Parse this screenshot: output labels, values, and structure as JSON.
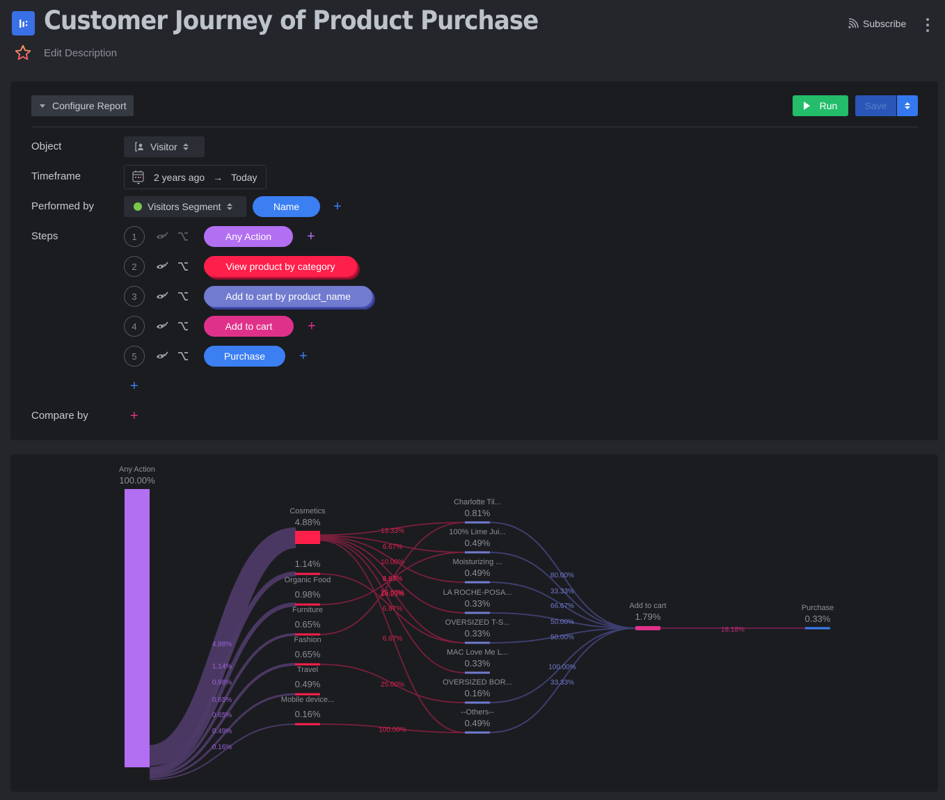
{
  "header": {
    "title": "Customer Journey of Product Purchase",
    "edit_description": "Edit Description",
    "subscribe": "Subscribe",
    "logo_icon": "bar-chart-logo-icon",
    "star_icon": "star-icon",
    "more_icon": "more-vertical-icon"
  },
  "config": {
    "configure_label": "Configure Report",
    "run_label": "Run",
    "save_label": "Save",
    "object": {
      "label": "Object",
      "value": "Visitor"
    },
    "timeframe": {
      "label": "Timeframe",
      "from": "2 years ago",
      "arrow": "→",
      "to": "Today"
    },
    "performed_by": {
      "label": "Performed by",
      "segment": "Visitors Segment",
      "segment_color": "#7bc74d",
      "property": "Name"
    },
    "steps_label": "Steps",
    "steps": [
      {
        "num": "1",
        "label": "Any Action",
        "color": "#b26ff2",
        "has_plus": true,
        "plus_color": "#b26ff2"
      },
      {
        "num": "2",
        "label": "View product by category",
        "color": "#ff1f4b",
        "has_plus": false
      },
      {
        "num": "3",
        "label": "Add to cart by product_name",
        "color": "#717bcf",
        "has_plus": false
      },
      {
        "num": "4",
        "label": "Add to cart",
        "color": "#e0318a",
        "has_plus": true,
        "plus_color": "#e0318a"
      },
      {
        "num": "5",
        "label": "Purchase",
        "color": "#3b7ff2",
        "has_plus": true,
        "plus_color": "#3b7ff2"
      }
    ],
    "compare_by_label": "Compare by",
    "plus": "+"
  },
  "chart_data": {
    "type": "sankey",
    "columns": [
      {
        "step": "Any Action",
        "color": "#b26ff2",
        "nodes": [
          {
            "name": "Any Action",
            "value": "100.00%"
          }
        ]
      },
      {
        "step": "View product by category",
        "color": "#ff1f4b",
        "nodes": [
          {
            "name": "Cosmetics",
            "value": "4.88%"
          },
          {
            "name": "",
            "value": "1.14%"
          },
          {
            "name": "Organic Food",
            "value": "0.98%"
          },
          {
            "name": "Furniture",
            "value": "0.65%"
          },
          {
            "name": "Fashion",
            "value": "0.65%"
          },
          {
            "name": "Travel",
            "value": "0.49%"
          },
          {
            "name": "Mobile device...",
            "value": "0.16%"
          }
        ]
      },
      {
        "step": "Add to cart by product_name",
        "color": "#717bcf",
        "nodes": [
          {
            "name": "Charlotte Til...",
            "value": "0.81%"
          },
          {
            "name": "100% Lime Jui...",
            "value": "0.49%"
          },
          {
            "name": "Moisturizing ...",
            "value": "0.49%"
          },
          {
            "name": "LA ROCHE-POSA...",
            "value": "0.33%"
          },
          {
            "name": "OVERSIZED T-S...",
            "value": "0.33%"
          },
          {
            "name": "MAC Love Me L...",
            "value": "0.33%"
          },
          {
            "name": "OVERSIZED BOR...",
            "value": "0.16%"
          },
          {
            "name": "--Others--",
            "value": "0.49%"
          }
        ]
      },
      {
        "step": "Add to cart",
        "color": "#e0318a",
        "nodes": [
          {
            "name": "Add to cart",
            "value": "1.79%"
          }
        ]
      },
      {
        "step": "Purchase",
        "color": "#3b7ff2",
        "nodes": [
          {
            "name": "Purchase",
            "value": "0.33%"
          }
        ]
      }
    ],
    "links_step1_to_2": [
      {
        "to": 0,
        "label": "4.88%",
        "value": 4.88
      },
      {
        "to": 1,
        "label": "1.14%",
        "value": 1.14
      },
      {
        "to": 2,
        "label": "0.98%",
        "value": 0.98
      },
      {
        "to": 3,
        "label": "0.65%",
        "value": 0.65
      },
      {
        "to": 4,
        "label": "0.65%",
        "value": 0.65
      },
      {
        "to": 5,
        "label": "0.49%",
        "value": 0.49
      },
      {
        "to": 6,
        "label": "0.16%",
        "value": 0.16
      }
    ],
    "links_step2_to_3": [
      {
        "from": 0,
        "to": 0,
        "label": "13.33%"
      },
      {
        "from": 0,
        "to": 1,
        "label": "6.67%"
      },
      {
        "from": 0,
        "to": 2,
        "label": "10.00%"
      },
      {
        "from": 0,
        "to": 3,
        "label": "3.33%"
      },
      {
        "from": 0,
        "to": 4,
        "label": "6.67%"
      },
      {
        "from": 0,
        "to": 5,
        "label": "6.67%"
      },
      {
        "from": 0,
        "to": 7,
        "label": "6.67%"
      },
      {
        "from": 1,
        "to": 4,
        "label": "14.29%"
      },
      {
        "from": 2,
        "to": 1,
        "label": "25.00%"
      },
      {
        "from": 3,
        "to": 0,
        "label": "25.00%"
      },
      {
        "from": 4,
        "to": 6,
        "label": "25.00%"
      },
      {
        "from": 6,
        "to": 7,
        "label": "100.00%"
      }
    ],
    "links_step3_to_4": [
      {
        "from": 0,
        "label": "80.00%"
      },
      {
        "from": 1,
        "label": "33.33%"
      },
      {
        "from": 2,
        "label": "66.67%"
      },
      {
        "from": 3,
        "label": "50.00%"
      },
      {
        "from": 4,
        "label": "50.00%"
      },
      {
        "from": 6,
        "label": "100.00%"
      },
      {
        "from": 7,
        "label": "33.33%"
      }
    ],
    "links_step4_to_5": [
      {
        "from": 0,
        "to": 0,
        "label": "18.18%"
      }
    ]
  }
}
